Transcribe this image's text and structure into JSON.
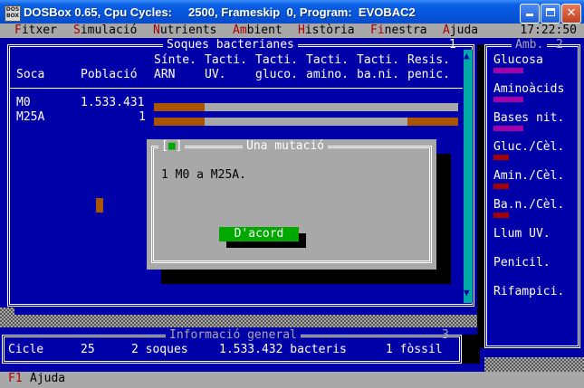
{
  "window": {
    "icon_text": "DOS BOX",
    "title": "DOSBox 0.65, Cpu Cycles:     2500, Frameskip  0, Program:  EVOBAC2",
    "controls": [
      "minimize",
      "maximize",
      "close"
    ]
  },
  "menu": {
    "items": [
      {
        "hot": "F",
        "rest": "itxer"
      },
      {
        "hot": "S",
        "rest": "imulació"
      },
      {
        "hot": "N",
        "rest": "utrients"
      },
      {
        "hot": "Am",
        "rest": "bient"
      },
      {
        "hot": "H",
        "rest": "istòria"
      },
      {
        "hot": "Fi",
        "rest": "nestra"
      },
      {
        "hot": "A",
        "rest": "juda"
      }
    ],
    "clock": "17:22:50"
  },
  "strains_window": {
    "title": "Soques bacterianes",
    "number": "1",
    "headers": {
      "soca": "Soca",
      "poblacio": "Població",
      "cols": [
        {
          "l1": "Sínte.",
          "l2": "ARN"
        },
        {
          "l1": "Tacti.",
          "l2": "UV."
        },
        {
          "l1": "Tacti.",
          "l2": "gluco."
        },
        {
          "l1": "Tacti.",
          "l2": "amino."
        },
        {
          "l1": "Tacti.",
          "l2": "ba.ni."
        },
        {
          "l1": "Resis.",
          "l2": "penic."
        }
      ]
    },
    "rows": [
      {
        "name": "M0",
        "population": "1.533.431"
      },
      {
        "name": "M25A",
        "population": "1"
      }
    ]
  },
  "environment_panel": {
    "title": "Amb.",
    "number": "2",
    "items": [
      {
        "label": "Glucosa",
        "bar_color": "#a800a8",
        "has_bar": true
      },
      {
        "label": "Aminoàcids",
        "bar_color": "#a800a8",
        "has_bar": true
      },
      {
        "label": "Bases nit.",
        "bar_color": "#a800a8",
        "has_bar": true
      },
      {
        "label": "Gluc./Cèl.",
        "bar_color": "#a80000",
        "has_bar": true
      },
      {
        "label": "Amin./Cèl.",
        "bar_color": "#a80000",
        "has_bar": true
      },
      {
        "label": "Ba.n./Cèl.",
        "bar_color": "#a80000",
        "has_bar": true
      },
      {
        "label": "Llum UV.",
        "has_bar": false
      },
      {
        "label": "Penicil.",
        "has_bar": false
      },
      {
        "label": "Rifampici.",
        "has_bar": false
      }
    ]
  },
  "dialog": {
    "title": "Una mutació",
    "close_symbol": "■",
    "message": "1 M0 a M25A.",
    "ok_label": "D'acord"
  },
  "info_window": {
    "title": "Informació general",
    "number": "3",
    "cycle_label": "Cicle",
    "cycle_value": "25",
    "strains": "2 soques",
    "bacteria": "1.533.432 bacteris",
    "fossils": "1 fòssil"
  },
  "status_bar": {
    "key": "F1",
    "label": "Ajuda"
  },
  "colors": {
    "dos_blue": "#0000a8",
    "gray": "#a8a8a8",
    "brown": "#a85400",
    "green": "#00a800",
    "magenta": "#a800a8",
    "red": "#a80000",
    "cyan": "#00a8a8"
  }
}
